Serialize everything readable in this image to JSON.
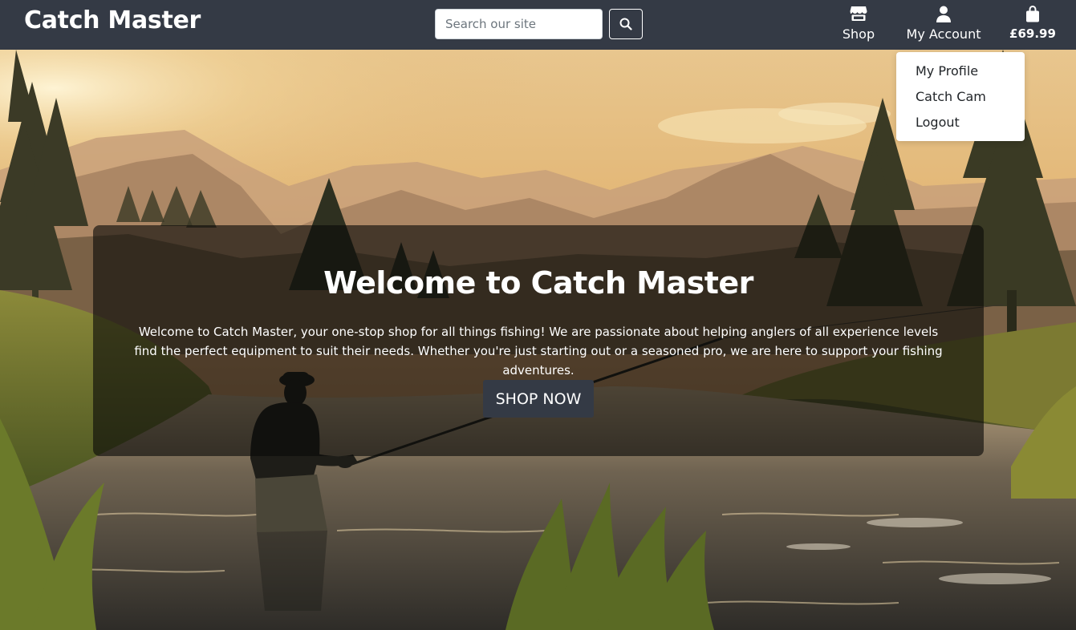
{
  "navbar": {
    "brand": "Catch Master",
    "search": {
      "placeholder": "Search our site",
      "value": ""
    },
    "items": [
      {
        "label": "Shop",
        "icon": "shop-icon"
      },
      {
        "label": "My Account",
        "icon": "user-icon"
      },
      {
        "label": "£69.99",
        "icon": "shopping-bag-icon"
      }
    ]
  },
  "dropdown": {
    "items": [
      {
        "label": "My Profile"
      },
      {
        "label": "Catch Cam"
      },
      {
        "label": "Logout"
      }
    ]
  },
  "hero": {
    "title": "Welcome to Catch Master",
    "description": "Welcome to Catch Master, your one-stop shop for all things fishing! We are passionate about helping anglers of all experience levels find the perfect equipment to suit their needs. Whether you're just starting out or a seasoned pro, we are here to support your fishing adventures.",
    "button_label": "SHOP NOW"
  },
  "colors": {
    "navbar_bg": "#343a45",
    "button_bg": "#343a45",
    "overlay_bg": "rgba(10,10,8,0.62)"
  }
}
